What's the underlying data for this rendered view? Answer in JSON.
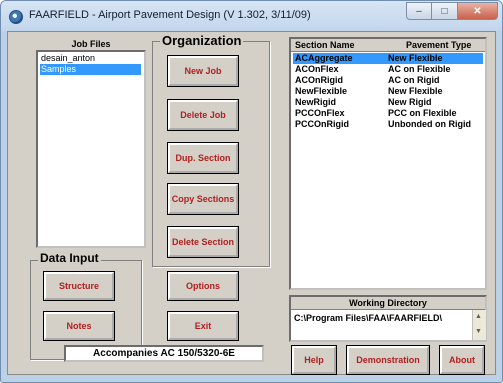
{
  "window": {
    "title": "FAARFIELD - Airport Pavement Design (V 1.302, 3/11/09)",
    "controls": {
      "minimize": "–",
      "maximize": "□",
      "close": "✕"
    }
  },
  "job_files": {
    "header": "Job Files",
    "items": [
      "desain_anton",
      "Samples"
    ],
    "selected_index": 1
  },
  "organization": {
    "label": "Organization",
    "buttons": [
      "New Job",
      "Delete Job",
      "Dup. Section",
      "Copy Sections",
      "Delete Section"
    ]
  },
  "data_input": {
    "label": "Data Input",
    "buttons": [
      "Structure",
      "Notes"
    ]
  },
  "middle_buttons": {
    "options": "Options",
    "exit": "Exit"
  },
  "sections": {
    "col_name": "Section Name",
    "col_type": "Pavement Type",
    "rows": [
      {
        "name": "ACAggregate",
        "type": "New Flexible"
      },
      {
        "name": "ACOnFlex",
        "type": "AC on Flexible"
      },
      {
        "name": "ACOnRigid",
        "type": "AC on Rigid"
      },
      {
        "name": "NewFlexible",
        "type": "New Flexible"
      },
      {
        "name": "NewRigid",
        "type": "New Rigid"
      },
      {
        "name": "PCCOnFlex",
        "type": "PCC on Flexible"
      },
      {
        "name": "PCCOnRigid",
        "type": "Unbonded on Rigid"
      }
    ],
    "selected_index": 0
  },
  "working_directory": {
    "label": "Working Directory",
    "path": "C:\\Program Files\\FAA\\FAARFIELD\\"
  },
  "footer_text": "Accompanies AC 150/5320-6E",
  "bottom_buttons": {
    "help": "Help",
    "demonstration": "Demonstration",
    "about": "About"
  }
}
